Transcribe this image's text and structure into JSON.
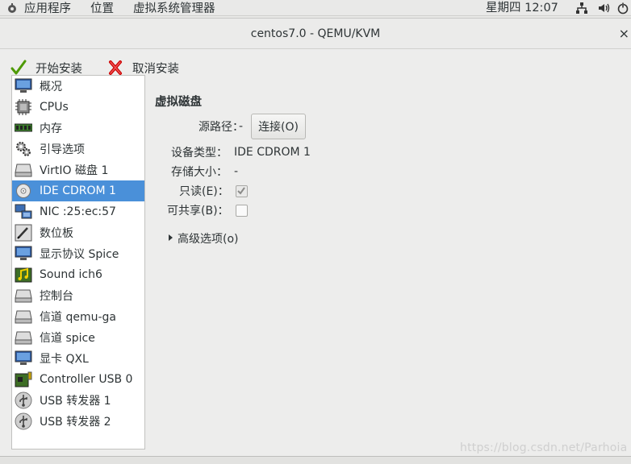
{
  "top_panel": {
    "menus": [
      "应用程序",
      "位置",
      "虚拟系统管理器"
    ],
    "clock": "星期四 12:07",
    "tray_icons": [
      "network-icon",
      "volume-icon",
      "power-icon"
    ]
  },
  "window": {
    "title": "centos7.0 - QEMU/KVM",
    "close_label": "×"
  },
  "toolbar": {
    "begin_install": "开始安装",
    "cancel_install": "取消安装"
  },
  "sidebar": {
    "selected_index": 5,
    "items": [
      {
        "label": "概况",
        "icon": "monitor-icon"
      },
      {
        "label": "CPUs",
        "icon": "cpu-icon"
      },
      {
        "label": "内存",
        "icon": "memory-icon"
      },
      {
        "label": "引导选项",
        "icon": "gears-icon"
      },
      {
        "label": "VirtIO 磁盘 1",
        "icon": "disk-icon"
      },
      {
        "label": "IDE CDROM 1",
        "icon": "cdrom-icon"
      },
      {
        "label": "NIC :25:ec:57",
        "icon": "nic-icon"
      },
      {
        "label": "数位板",
        "icon": "tablet-icon"
      },
      {
        "label": "显示协议 Spice",
        "icon": "display-icon"
      },
      {
        "label": "Sound ich6",
        "icon": "sound-icon"
      },
      {
        "label": "控制台",
        "icon": "console-icon"
      },
      {
        "label": "信道 qemu-ga",
        "icon": "channel-icon"
      },
      {
        "label": "信道 spice",
        "icon": "channel-icon"
      },
      {
        "label": "显卡 QXL",
        "icon": "video-icon"
      },
      {
        "label": "Controller USB 0",
        "icon": "controller-icon"
      },
      {
        "label": "USB 转发器 1",
        "icon": "usb-icon"
      },
      {
        "label": "USB 转发器 2",
        "icon": "usb-icon"
      }
    ]
  },
  "details": {
    "title": "虚拟磁盘",
    "source_label": "源路径：",
    "source_value": "-",
    "connect_button": "连接(O)",
    "device_type_label": "设备类型：",
    "device_type_value": "IDE CDROM 1",
    "storage_size_label": "存储大小：",
    "storage_size_value": "-",
    "readonly_label": "只读(E)：",
    "readonly_checked": true,
    "shareable_label": "可共享(B)：",
    "shareable_checked": false,
    "advanced_label": "高级选项(o)"
  },
  "watermark": "https://blog.csdn.net/Parhoia"
}
